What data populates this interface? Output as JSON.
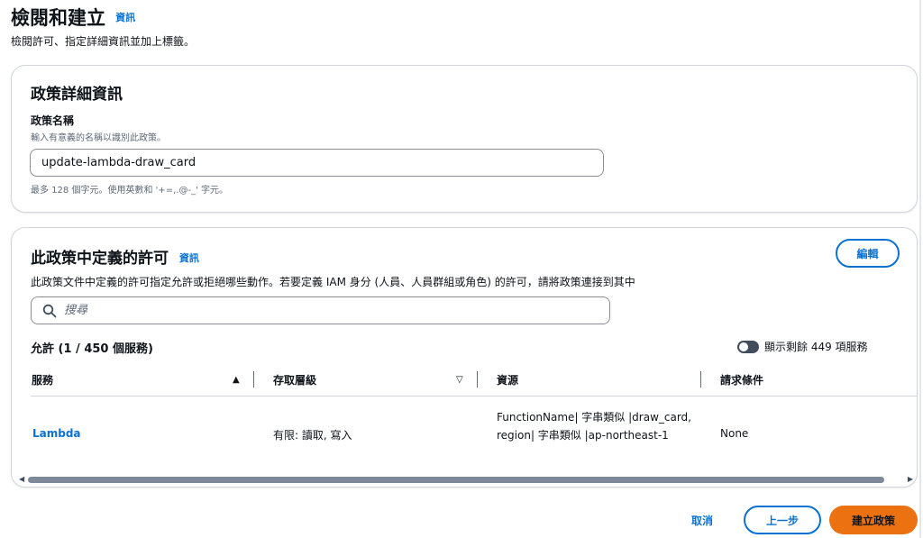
{
  "page": {
    "title": "檢閱和建立",
    "info_label": "資訊",
    "description": "檢閱許可、指定詳細資訊並加上標籤。"
  },
  "policy_details": {
    "title": "政策詳細資訊",
    "name_label": "政策名稱",
    "name_hint": "輸入有意義的名稱以識別此政策。",
    "name_value": "update-lambda-draw_card",
    "name_constraint": "最多 128 個字元。使用英數和 '+=,.@-_' 字元。"
  },
  "permissions": {
    "title": "此政策中定義的許可",
    "info_label": "資訊",
    "edit_label": "編輯",
    "description": "此政策文件中定義的許可指定允許或拒絕哪些動作。若要定義 IAM 身分 (人員、人員群組或角色) 的許可，請將政策連接到其中",
    "search_placeholder": "搜尋",
    "allow_heading": "允許 (1 / 450 個服務)",
    "toggle_label": "顯示剩餘 449 項服務",
    "toggle_on": true,
    "columns": {
      "service": "服務",
      "access_level": "存取層級",
      "resource": "資源",
      "request_condition": "請求條件"
    },
    "rows": [
      {
        "service": "Lambda",
        "access_level": "有限: 讀取, 寫入",
        "resource": "FunctionName| 字串類似 |draw_card, region| 字串類似 |ap-northeast-1",
        "request_condition": "None"
      }
    ]
  },
  "footer": {
    "cancel_label": "取消",
    "prev_label": "上一步",
    "create_label": "建立政策"
  },
  "colors": {
    "link": "#0972d3",
    "primary_button": "#ec7211",
    "border": "#d1d5db"
  }
}
